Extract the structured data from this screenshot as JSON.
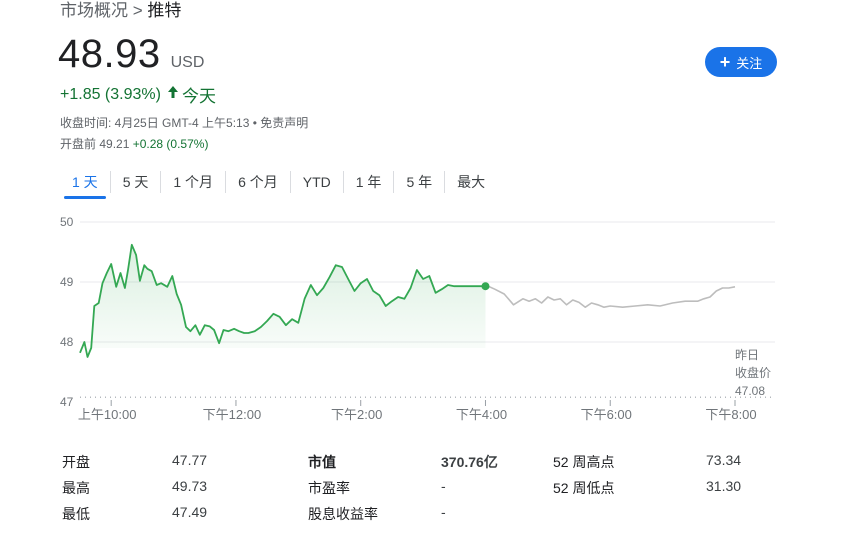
{
  "breadcrumb": {
    "parent": "市场概况",
    "separator": ">",
    "current": "推特"
  },
  "quote": {
    "price": "48.93",
    "currency": "USD",
    "change": "+1.85 (3.93%)",
    "change_period": "今天",
    "close_time": "收盘时间: 4月25日 GMT-4 上午5:13 • 免责声明",
    "premarket_label": "开盘前",
    "premarket_price": "49.21",
    "premarket_change": "+0.28 (0.57%)"
  },
  "follow_button": {
    "label": "关注"
  },
  "tabs": [
    {
      "label": "1 天",
      "active": true
    },
    {
      "label": "5 天",
      "active": false
    },
    {
      "label": "1 个月",
      "active": false
    },
    {
      "label": "6 个月",
      "active": false
    },
    {
      "label": "YTD",
      "active": false
    },
    {
      "label": "1 年",
      "active": false
    },
    {
      "label": "5 年",
      "active": false
    },
    {
      "label": "最大",
      "active": false
    }
  ],
  "chart_data": {
    "type": "line",
    "ylim": [
      47,
      50
    ],
    "y_ticks": [
      "50",
      "49",
      "48",
      "47"
    ],
    "x_range_hours": [
      9.5,
      20
    ],
    "x_ticks": [
      {
        "label": "上午10:00",
        "hour": 10
      },
      {
        "label": "下午12:00",
        "hour": 12
      },
      {
        "label": "下午2:00",
        "hour": 14
      },
      {
        "label": "下午4:00",
        "hour": 16
      },
      {
        "label": "下午6:00",
        "hour": 18
      },
      {
        "label": "下午8:00",
        "hour": 20
      }
    ],
    "previous_close": {
      "value": 47.08,
      "label_line1": "昨日",
      "label_line2": "收盘价",
      "label_value": "47.08"
    },
    "colors": {
      "regular": "#34a853",
      "extended": "#bdbdbd",
      "grid": "#e8eaed",
      "text": "#70757a"
    },
    "series": [
      {
        "segment": "regular",
        "x": [
          9.5,
          9.57,
          9.62,
          9.68,
          9.73,
          9.8,
          9.86,
          9.93,
          10,
          10.08,
          10.15,
          10.22,
          10.27,
          10.33,
          10.4,
          10.46,
          10.53,
          10.58,
          10.65,
          10.73,
          10.8,
          10.9,
          10.98,
          11.05,
          11.12,
          11.2,
          11.27,
          11.35,
          11.42,
          11.5,
          11.58,
          11.65,
          11.73,
          11.8,
          11.88,
          11.97,
          12.05,
          12.13,
          12.2,
          12.3,
          12.4,
          12.5,
          12.6,
          12.7,
          12.8,
          12.9,
          13.0,
          13.1,
          13.2,
          13.3,
          13.4,
          13.5,
          13.6,
          13.7,
          13.8,
          13.9,
          14.0,
          14.1,
          14.2,
          14.3,
          14.4,
          14.5,
          14.6,
          14.7,
          14.8,
          14.9,
          15.0,
          15.1,
          15.2,
          15.3,
          15.4,
          15.5,
          15.6,
          15.7,
          15.8,
          15.9,
          16.0
        ],
        "y": [
          47.82,
          48.0,
          47.75,
          47.9,
          48.6,
          48.65,
          48.98,
          49.15,
          49.3,
          48.92,
          49.15,
          48.9,
          49.2,
          49.62,
          49.45,
          49.02,
          49.28,
          49.22,
          49.18,
          48.95,
          48.98,
          48.92,
          49.1,
          48.8,
          48.62,
          48.25,
          48.18,
          48.28,
          48.12,
          48.28,
          48.26,
          48.2,
          47.98,
          48.2,
          48.18,
          48.22,
          48.18,
          48.15,
          48.15,
          48.18,
          48.25,
          48.35,
          48.47,
          48.42,
          48.28,
          48.38,
          48.32,
          48.72,
          48.95,
          48.78,
          48.9,
          49.08,
          49.28,
          49.25,
          49.05,
          48.85,
          48.98,
          49.05,
          48.85,
          48.78,
          48.6,
          48.68,
          48.75,
          48.72,
          48.9,
          49.2,
          49.05,
          49.1,
          48.82,
          48.88,
          48.95,
          48.93,
          48.93,
          48.93,
          48.93,
          48.93,
          48.93
        ]
      },
      {
        "segment": "extended",
        "x": [
          16.0,
          16.15,
          16.3,
          16.45,
          16.6,
          16.7,
          16.8,
          16.9,
          17.0,
          17.1,
          17.2,
          17.3,
          17.4,
          17.5,
          17.6,
          17.7,
          17.8,
          17.9,
          18.0,
          18.2,
          18.4,
          18.6,
          18.8,
          19.0,
          19.2,
          19.4,
          19.5,
          19.6,
          19.7,
          19.8,
          19.9,
          20.0
        ],
        "y": [
          48.95,
          48.88,
          48.8,
          48.62,
          48.72,
          48.68,
          48.72,
          48.65,
          48.75,
          48.7,
          48.72,
          48.62,
          48.7,
          48.66,
          48.58,
          48.65,
          48.62,
          48.58,
          48.6,
          48.58,
          48.6,
          48.62,
          48.6,
          48.65,
          48.68,
          48.68,
          48.72,
          48.75,
          48.85,
          48.9,
          48.9,
          48.92
        ]
      }
    ]
  },
  "stats": [
    {
      "label": "开盘",
      "value": "47.77"
    },
    {
      "label": "最高",
      "value": "49.73"
    },
    {
      "label": "最低",
      "value": "47.49"
    },
    {
      "label": "市值",
      "value": "370.76亿"
    },
    {
      "label": "市盈率",
      "value": "-"
    },
    {
      "label": "股息收益率",
      "value": "-"
    },
    {
      "label": "52 周高点",
      "value": "73.34"
    },
    {
      "label": "52 周低点",
      "value": "31.30"
    }
  ]
}
